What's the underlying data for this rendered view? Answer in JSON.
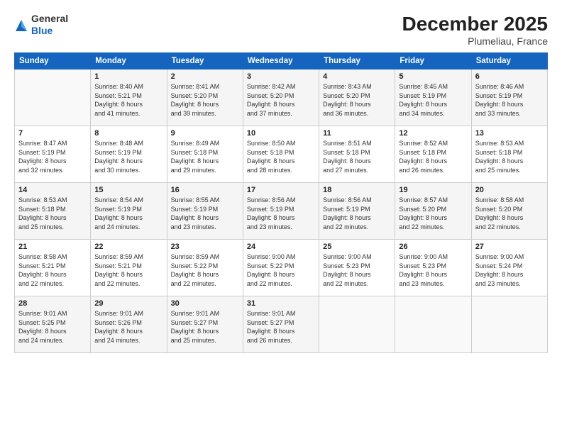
{
  "header": {
    "logo_general": "General",
    "logo_blue": "Blue",
    "title": "December 2025",
    "location": "Plumeliau, France"
  },
  "calendar": {
    "days_of_week": [
      "Sunday",
      "Monday",
      "Tuesday",
      "Wednesday",
      "Thursday",
      "Friday",
      "Saturday"
    ],
    "weeks": [
      [
        {
          "day": "",
          "detail": ""
        },
        {
          "day": "1",
          "detail": "Sunrise: 8:40 AM\nSunset: 5:21 PM\nDaylight: 8 hours\nand 41 minutes."
        },
        {
          "day": "2",
          "detail": "Sunrise: 8:41 AM\nSunset: 5:20 PM\nDaylight: 8 hours\nand 39 minutes."
        },
        {
          "day": "3",
          "detail": "Sunrise: 8:42 AM\nSunset: 5:20 PM\nDaylight: 8 hours\nand 37 minutes."
        },
        {
          "day": "4",
          "detail": "Sunrise: 8:43 AM\nSunset: 5:20 PM\nDaylight: 8 hours\nand 36 minutes."
        },
        {
          "day": "5",
          "detail": "Sunrise: 8:45 AM\nSunset: 5:19 PM\nDaylight: 8 hours\nand 34 minutes."
        },
        {
          "day": "6",
          "detail": "Sunrise: 8:46 AM\nSunset: 5:19 PM\nDaylight: 8 hours\nand 33 minutes."
        }
      ],
      [
        {
          "day": "7",
          "detail": "Sunrise: 8:47 AM\nSunset: 5:19 PM\nDaylight: 8 hours\nand 32 minutes."
        },
        {
          "day": "8",
          "detail": "Sunrise: 8:48 AM\nSunset: 5:19 PM\nDaylight: 8 hours\nand 30 minutes."
        },
        {
          "day": "9",
          "detail": "Sunrise: 8:49 AM\nSunset: 5:18 PM\nDaylight: 8 hours\nand 29 minutes."
        },
        {
          "day": "10",
          "detail": "Sunrise: 8:50 AM\nSunset: 5:18 PM\nDaylight: 8 hours\nand 28 minutes."
        },
        {
          "day": "11",
          "detail": "Sunrise: 8:51 AM\nSunset: 5:18 PM\nDaylight: 8 hours\nand 27 minutes."
        },
        {
          "day": "12",
          "detail": "Sunrise: 8:52 AM\nSunset: 5:18 PM\nDaylight: 8 hours\nand 26 minutes."
        },
        {
          "day": "13",
          "detail": "Sunrise: 8:53 AM\nSunset: 5:18 PM\nDaylight: 8 hours\nand 25 minutes."
        }
      ],
      [
        {
          "day": "14",
          "detail": "Sunrise: 8:53 AM\nSunset: 5:18 PM\nDaylight: 8 hours\nand 25 minutes."
        },
        {
          "day": "15",
          "detail": "Sunrise: 8:54 AM\nSunset: 5:19 PM\nDaylight: 8 hours\nand 24 minutes."
        },
        {
          "day": "16",
          "detail": "Sunrise: 8:55 AM\nSunset: 5:19 PM\nDaylight: 8 hours\nand 23 minutes."
        },
        {
          "day": "17",
          "detail": "Sunrise: 8:56 AM\nSunset: 5:19 PM\nDaylight: 8 hours\nand 23 minutes."
        },
        {
          "day": "18",
          "detail": "Sunrise: 8:56 AM\nSunset: 5:19 PM\nDaylight: 8 hours\nand 22 minutes."
        },
        {
          "day": "19",
          "detail": "Sunrise: 8:57 AM\nSunset: 5:20 PM\nDaylight: 8 hours\nand 22 minutes."
        },
        {
          "day": "20",
          "detail": "Sunrise: 8:58 AM\nSunset: 5:20 PM\nDaylight: 8 hours\nand 22 minutes."
        }
      ],
      [
        {
          "day": "21",
          "detail": "Sunrise: 8:58 AM\nSunset: 5:21 PM\nDaylight: 8 hours\nand 22 minutes."
        },
        {
          "day": "22",
          "detail": "Sunrise: 8:59 AM\nSunset: 5:21 PM\nDaylight: 8 hours\nand 22 minutes."
        },
        {
          "day": "23",
          "detail": "Sunrise: 8:59 AM\nSunset: 5:22 PM\nDaylight: 8 hours\nand 22 minutes."
        },
        {
          "day": "24",
          "detail": "Sunrise: 9:00 AM\nSunset: 5:22 PM\nDaylight: 8 hours\nand 22 minutes."
        },
        {
          "day": "25",
          "detail": "Sunrise: 9:00 AM\nSunset: 5:23 PM\nDaylight: 8 hours\nand 22 minutes."
        },
        {
          "day": "26",
          "detail": "Sunrise: 9:00 AM\nSunset: 5:23 PM\nDaylight: 8 hours\nand 23 minutes."
        },
        {
          "day": "27",
          "detail": "Sunrise: 9:00 AM\nSunset: 5:24 PM\nDaylight: 8 hours\nand 23 minutes."
        }
      ],
      [
        {
          "day": "28",
          "detail": "Sunrise: 9:01 AM\nSunset: 5:25 PM\nDaylight: 8 hours\nand 24 minutes."
        },
        {
          "day": "29",
          "detail": "Sunrise: 9:01 AM\nSunset: 5:26 PM\nDaylight: 8 hours\nand 24 minutes."
        },
        {
          "day": "30",
          "detail": "Sunrise: 9:01 AM\nSunset: 5:27 PM\nDaylight: 8 hours\nand 25 minutes."
        },
        {
          "day": "31",
          "detail": "Sunrise: 9:01 AM\nSunset: 5:27 PM\nDaylight: 8 hours\nand 26 minutes."
        },
        {
          "day": "",
          "detail": ""
        },
        {
          "day": "",
          "detail": ""
        },
        {
          "day": "",
          "detail": ""
        }
      ]
    ]
  }
}
